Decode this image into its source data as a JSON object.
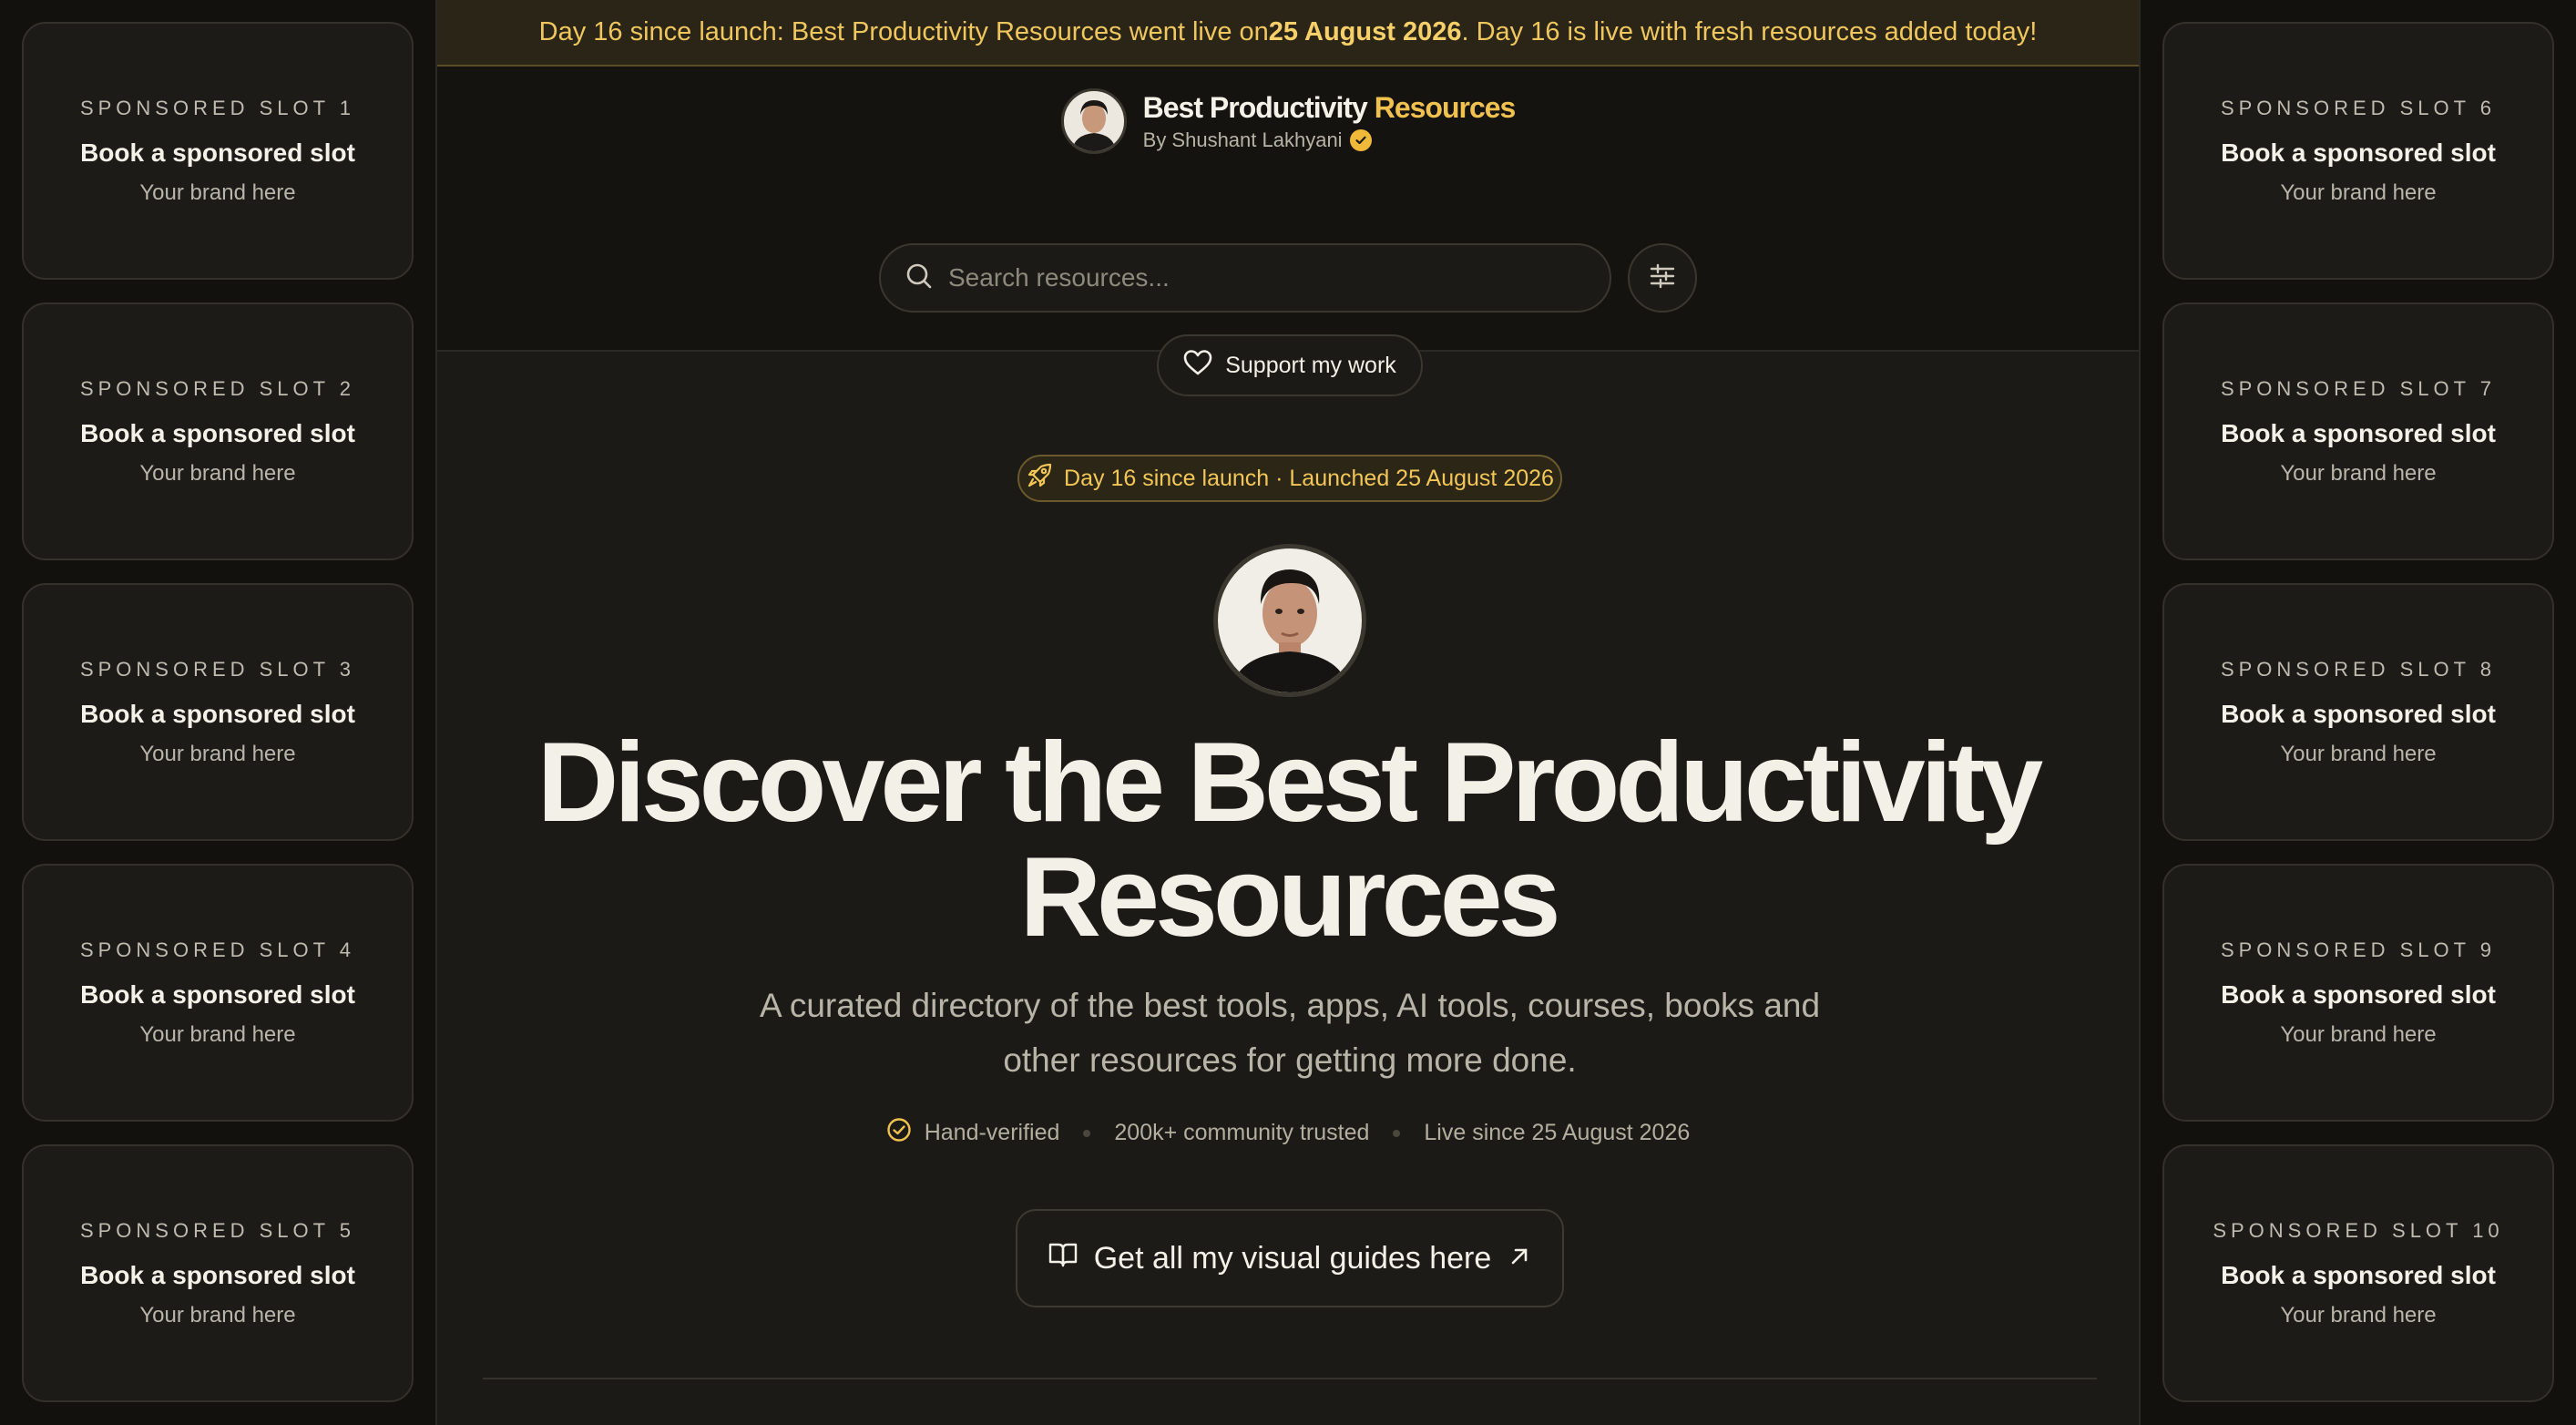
{
  "banner": {
    "text_before": "Day 16 since launch: Best Productivity Resources went live on ",
    "date_bold": "25 August 2026",
    "text_after": ". Day 16 is live with fresh resources added today!"
  },
  "brand": {
    "name_main": "Best Productivity",
    "name_accent": "Resources",
    "by_line": "By Shushant Lakhyani"
  },
  "search": {
    "placeholder": "Search resources..."
  },
  "support": {
    "label": "Support my work"
  },
  "hero": {
    "launch_pill": "Day 16 since launch · Launched 25 August 2026",
    "title_line1": "Discover the Best Productivity",
    "title_line2": "Resources",
    "subtitle": "A curated directory of the best tools, apps, AI tools, courses, books and other resources for getting more done.",
    "meta": [
      "Hand-verified",
      "200k+ community trusted",
      "Live since 25 August 2026"
    ],
    "guides_label": "Get all my visual guides here"
  },
  "sponsors_left": [
    {
      "kicker": "SPONSORED SLOT 1",
      "title": "Book a sponsored slot",
      "sub": "Your brand here"
    },
    {
      "kicker": "SPONSORED SLOT 2",
      "title": "Book a sponsored slot",
      "sub": "Your brand here"
    },
    {
      "kicker": "SPONSORED SLOT 3",
      "title": "Book a sponsored slot",
      "sub": "Your brand here"
    },
    {
      "kicker": "SPONSORED SLOT 4",
      "title": "Book a sponsored slot",
      "sub": "Your brand here"
    },
    {
      "kicker": "SPONSORED SLOT 5",
      "title": "Book a sponsored slot",
      "sub": "Your brand here"
    }
  ],
  "sponsors_right": [
    {
      "kicker": "SPONSORED SLOT 6",
      "title": "Book a sponsored slot",
      "sub": "Your brand here"
    },
    {
      "kicker": "SPONSORED SLOT 7",
      "title": "Book a sponsored slot",
      "sub": "Your brand here"
    },
    {
      "kicker": "SPONSORED SLOT 8",
      "title": "Book a sponsored slot",
      "sub": "Your brand here"
    },
    {
      "kicker": "SPONSORED SLOT 9",
      "title": "Book a sponsored slot",
      "sub": "Your brand here"
    },
    {
      "kicker": "SPONSORED SLOT 10",
      "title": "Book a sponsored slot",
      "sub": "Your brand here"
    }
  ],
  "colors": {
    "accent_gold": "#f0c14f",
    "background": "#1b1a16",
    "banner_bg": "#2a2516"
  },
  "icons": {
    "search": "search-icon",
    "filter": "sliders-icon",
    "support": "heart-icon",
    "launch": "rocket-icon",
    "verified": "verified-badge-icon",
    "hand_verified": "check-circle-icon",
    "guides": "open-book-icon",
    "external": "arrow-up-right-icon"
  }
}
